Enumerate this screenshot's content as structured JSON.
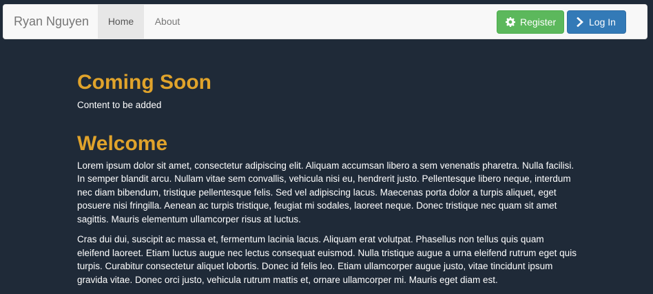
{
  "navbar": {
    "brand": "Ryan Nguyen",
    "links": [
      {
        "label": "Home",
        "active": true
      },
      {
        "label": "About",
        "active": false
      }
    ],
    "register": {
      "label": "Register",
      "icon": "gear-icon",
      "color": "#5cb85c"
    },
    "login": {
      "label": "Log In",
      "icon": "chevron-right-icon",
      "color": "#337ab7"
    }
  },
  "main": {
    "section1": {
      "title": "Coming Soon",
      "text": "Content to be added"
    },
    "section2": {
      "title": "Welcome",
      "paragraphs": [
        "Lorem ipsum dolor sit amet, consectetur adipiscing elit. Aliquam accumsan libero a sem venenatis pharetra. Nulla facilisi. In semper blandit arcu. Nullam vitae sem convallis, vehicula nisi eu, hendrerit justo. Pellentesque libero neque, interdum nec diam bibendum, tristique pellentesque felis. Sed vel adipiscing lacus. Maecenas porta dolor a turpis aliquet, eget posuere nisi fringilla. Aenean ac turpis tristique, feugiat mi sodales, laoreet neque. Donec tristique nec quam sit amet sagittis. Mauris elementum ullamcorper risus at luctus.",
        "Cras dui dui, suscipit ac massa et, fermentum lacinia lacus. Aliquam erat volutpat. Phasellus non tellus quis quam eleifend laoreet. Etiam luctus augue nec lectus consequat euismod. Nulla tristique augue a urna eleifend rutrum eget quis turpis. Curabitur consectetur aliquet lobortis. Donec id felis leo. Etiam ullamcorper augue justo, vitae tincidunt ipsum gravida vitae. Donec orci justo, vehicula rutrum mattis et, ornare ullamcorper mi. Mauris eget diam est."
      ]
    }
  },
  "colors": {
    "background": "#1f2a38",
    "heading": "#e0a32b",
    "navbar": "#f8f8f8"
  }
}
